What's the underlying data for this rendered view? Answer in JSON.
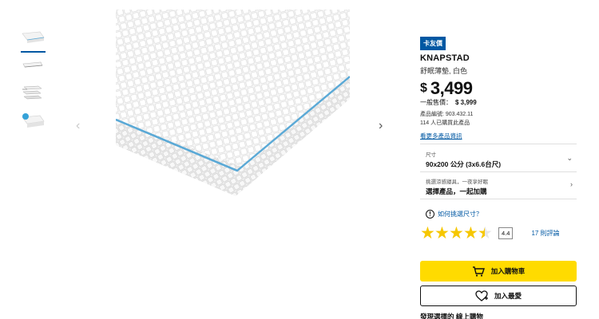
{
  "gallery": {
    "thumbnails": [
      "mattress-corner",
      "mattress-flat",
      "mattress-layers",
      "mattress-corner-badge"
    ],
    "selected_index": 0,
    "prev_label": "‹",
    "next_label": "›"
  },
  "product": {
    "badge": "卡友價",
    "name": "KNAPSTAD",
    "description": "舒眠薄墊, 白色",
    "price_currency": "$",
    "price_amount": "3,499",
    "regular_label": "一般售價：",
    "regular_price": "$ 3,999",
    "article_number": "產品編號: 903.432.11",
    "purchased_count": "114 人已購買此產品",
    "more_info_link": "看更多產品資訊"
  },
  "options": {
    "size_label": "尺寸",
    "size_value": "90x200 公分 (3x6.6台尺)",
    "bundle_label": "挑選涼感寢具，一夜享好眠",
    "bundle_value": "選擇產品，一起加購"
  },
  "help": {
    "icon": "!",
    "text": "如何挑選尺寸？"
  },
  "rating": {
    "value": 4.4,
    "stars_full": 4,
    "score_label": "4.4",
    "reviews_label": "17 則評論"
  },
  "actions": {
    "add_to_cart": "加入購物車",
    "add_to_favorites": "加入最愛"
  },
  "footer_cut": "發現選擇的 線上購物",
  "colors": {
    "accent_blue": "#0058a3",
    "cart_yellow": "#ffdb00",
    "star_yellow": "#f6c700",
    "mattress_piping": "#5aa9d6"
  }
}
